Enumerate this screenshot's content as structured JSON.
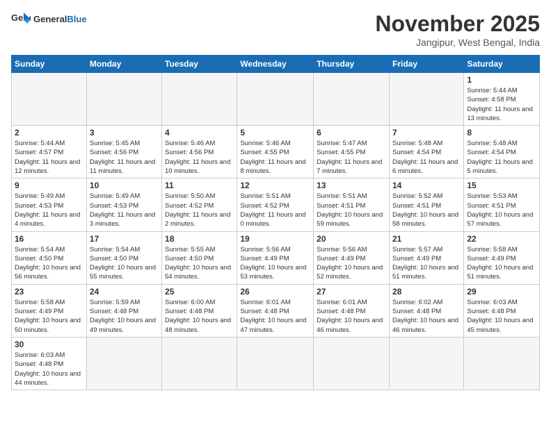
{
  "header": {
    "logo_general": "General",
    "logo_blue": "Blue",
    "month_title": "November 2025",
    "location": "Jangipur, West Bengal, India"
  },
  "weekdays": [
    "Sunday",
    "Monday",
    "Tuesday",
    "Wednesday",
    "Thursday",
    "Friday",
    "Saturday"
  ],
  "weeks": [
    [
      {
        "day": "",
        "info": ""
      },
      {
        "day": "",
        "info": ""
      },
      {
        "day": "",
        "info": ""
      },
      {
        "day": "",
        "info": ""
      },
      {
        "day": "",
        "info": ""
      },
      {
        "day": "",
        "info": ""
      },
      {
        "day": "1",
        "info": "Sunrise: 5:44 AM\nSunset: 4:58 PM\nDaylight: 11 hours and 13 minutes."
      }
    ],
    [
      {
        "day": "2",
        "info": "Sunrise: 5:44 AM\nSunset: 4:57 PM\nDaylight: 11 hours and 12 minutes."
      },
      {
        "day": "3",
        "info": "Sunrise: 5:45 AM\nSunset: 4:56 PM\nDaylight: 11 hours and 11 minutes."
      },
      {
        "day": "4",
        "info": "Sunrise: 5:46 AM\nSunset: 4:56 PM\nDaylight: 11 hours and 10 minutes."
      },
      {
        "day": "5",
        "info": "Sunrise: 5:46 AM\nSunset: 4:55 PM\nDaylight: 11 hours and 8 minutes."
      },
      {
        "day": "6",
        "info": "Sunrise: 5:47 AM\nSunset: 4:55 PM\nDaylight: 11 hours and 7 minutes."
      },
      {
        "day": "7",
        "info": "Sunrise: 5:48 AM\nSunset: 4:54 PM\nDaylight: 11 hours and 6 minutes."
      },
      {
        "day": "8",
        "info": "Sunrise: 5:48 AM\nSunset: 4:54 PM\nDaylight: 11 hours and 5 minutes."
      }
    ],
    [
      {
        "day": "9",
        "info": "Sunrise: 5:49 AM\nSunset: 4:53 PM\nDaylight: 11 hours and 4 minutes."
      },
      {
        "day": "10",
        "info": "Sunrise: 5:49 AM\nSunset: 4:53 PM\nDaylight: 11 hours and 3 minutes."
      },
      {
        "day": "11",
        "info": "Sunrise: 5:50 AM\nSunset: 4:52 PM\nDaylight: 11 hours and 2 minutes."
      },
      {
        "day": "12",
        "info": "Sunrise: 5:51 AM\nSunset: 4:52 PM\nDaylight: 11 hours and 0 minutes."
      },
      {
        "day": "13",
        "info": "Sunrise: 5:51 AM\nSunset: 4:51 PM\nDaylight: 10 hours and 59 minutes."
      },
      {
        "day": "14",
        "info": "Sunrise: 5:52 AM\nSunset: 4:51 PM\nDaylight: 10 hours and 58 minutes."
      },
      {
        "day": "15",
        "info": "Sunrise: 5:53 AM\nSunset: 4:51 PM\nDaylight: 10 hours and 57 minutes."
      }
    ],
    [
      {
        "day": "16",
        "info": "Sunrise: 5:54 AM\nSunset: 4:50 PM\nDaylight: 10 hours and 56 minutes."
      },
      {
        "day": "17",
        "info": "Sunrise: 5:54 AM\nSunset: 4:50 PM\nDaylight: 10 hours and 55 minutes."
      },
      {
        "day": "18",
        "info": "Sunrise: 5:55 AM\nSunset: 4:50 PM\nDaylight: 10 hours and 54 minutes."
      },
      {
        "day": "19",
        "info": "Sunrise: 5:56 AM\nSunset: 4:49 PM\nDaylight: 10 hours and 53 minutes."
      },
      {
        "day": "20",
        "info": "Sunrise: 5:56 AM\nSunset: 4:49 PM\nDaylight: 10 hours and 52 minutes."
      },
      {
        "day": "21",
        "info": "Sunrise: 5:57 AM\nSunset: 4:49 PM\nDaylight: 10 hours and 51 minutes."
      },
      {
        "day": "22",
        "info": "Sunrise: 5:58 AM\nSunset: 4:49 PM\nDaylight: 10 hours and 51 minutes."
      }
    ],
    [
      {
        "day": "23",
        "info": "Sunrise: 5:58 AM\nSunset: 4:49 PM\nDaylight: 10 hours and 50 minutes."
      },
      {
        "day": "24",
        "info": "Sunrise: 5:59 AM\nSunset: 4:48 PM\nDaylight: 10 hours and 49 minutes."
      },
      {
        "day": "25",
        "info": "Sunrise: 6:00 AM\nSunset: 4:48 PM\nDaylight: 10 hours and 48 minutes."
      },
      {
        "day": "26",
        "info": "Sunrise: 6:01 AM\nSunset: 4:48 PM\nDaylight: 10 hours and 47 minutes."
      },
      {
        "day": "27",
        "info": "Sunrise: 6:01 AM\nSunset: 4:48 PM\nDaylight: 10 hours and 46 minutes."
      },
      {
        "day": "28",
        "info": "Sunrise: 6:02 AM\nSunset: 4:48 PM\nDaylight: 10 hours and 46 minutes."
      },
      {
        "day": "29",
        "info": "Sunrise: 6:03 AM\nSunset: 4:48 PM\nDaylight: 10 hours and 45 minutes."
      }
    ],
    [
      {
        "day": "30",
        "info": "Sunrise: 6:03 AM\nSunset: 4:48 PM\nDaylight: 10 hours and 44 minutes."
      },
      {
        "day": "",
        "info": ""
      },
      {
        "day": "",
        "info": ""
      },
      {
        "day": "",
        "info": ""
      },
      {
        "day": "",
        "info": ""
      },
      {
        "day": "",
        "info": ""
      },
      {
        "day": "",
        "info": ""
      }
    ]
  ]
}
